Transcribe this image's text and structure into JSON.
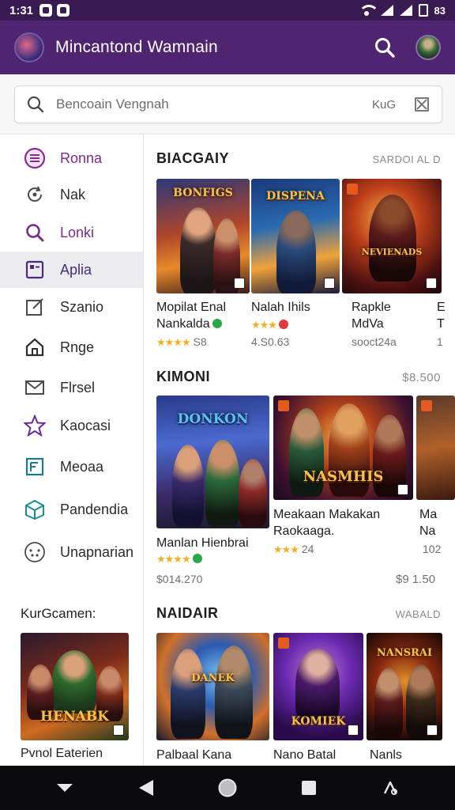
{
  "status_bar": {
    "time": "1:31",
    "indicator": "83"
  },
  "app_bar": {
    "title": "Mincantond Wamnain"
  },
  "search": {
    "placeholder": "Bencoain Vengnah",
    "hint": "KuG"
  },
  "sidebar": {
    "items": [
      {
        "label": "Ronna",
        "icon": "menu-circle-icon"
      },
      {
        "label": "Nak",
        "icon": "refresh-icon"
      },
      {
        "label": "Lonki",
        "icon": "search-icon"
      },
      {
        "label": "Aplia",
        "icon": "apps-icon"
      },
      {
        "label": "Szanio",
        "icon": "edit-icon"
      },
      {
        "label": "Rnge",
        "icon": "home-icon"
      },
      {
        "label": "Flrsel",
        "icon": "mail-icon"
      },
      {
        "label": "Kaocasi",
        "icon": "star-icon"
      },
      {
        "label": "Meoaa",
        "icon": "book-icon"
      },
      {
        "label": "Pandendia",
        "icon": "cube-icon"
      },
      {
        "label": "Unapnarian",
        "icon": "dots-circle-icon"
      }
    ],
    "heading": "KurGcamen:",
    "card": {
      "title": "Pvnol Eaterien",
      "logo": "HENABK"
    }
  },
  "sections": [
    {
      "title": "BIACGAIY",
      "meta": "SARDOI AL D",
      "cards": [
        {
          "title1": "Mopilat Enal",
          "title2": "Nankalda",
          "rating": "★★★★",
          "sub": "S8",
          "logo": "BONFIGS"
        },
        {
          "title1": "Nalah Ihils",
          "title2": "",
          "rating": "★★★",
          "sub": "4.S0.63",
          "logo": "DISPENA"
        },
        {
          "title1": "Rapkle",
          "title2": "MdVa",
          "rating": "",
          "sub": "sooct24a",
          "logo": "NEVIENADS"
        },
        {
          "title1": "E",
          "title2": "T",
          "rating": "",
          "sub": "1",
          "logo": ""
        }
      ]
    },
    {
      "title": "KIMONI",
      "meta": "$8.500",
      "cards": [
        {
          "title1": "Manlan Hienbrai",
          "title2": "",
          "rating": "★★★★",
          "sub": "$014.270",
          "logo": "DONKON"
        },
        {
          "title1": "Meakaan Makakan",
          "title2": "Raokaaga.",
          "rating": "★★★",
          "sub": "24",
          "logo": "NASMHIS"
        },
        {
          "title1": "Ma",
          "title2": "Na",
          "rating": "",
          "sub": "102",
          "logo": ""
        }
      ],
      "trailing_price": "$9 1.50"
    },
    {
      "title": "NAIDAIR",
      "meta": "WABALD",
      "cards": [
        {
          "title1": "Palbaal Kana",
          "logo": "DANEK"
        },
        {
          "title1": "Nano Batal",
          "logo": "KOMIEK"
        },
        {
          "title1": "Nanls",
          "logo": "NANSRAI"
        }
      ]
    }
  ],
  "colors": {
    "app_bar": "#4f2471",
    "status_bar": "#3a1a52",
    "accent": "#7b2a8e",
    "star": "#f2b01e"
  }
}
